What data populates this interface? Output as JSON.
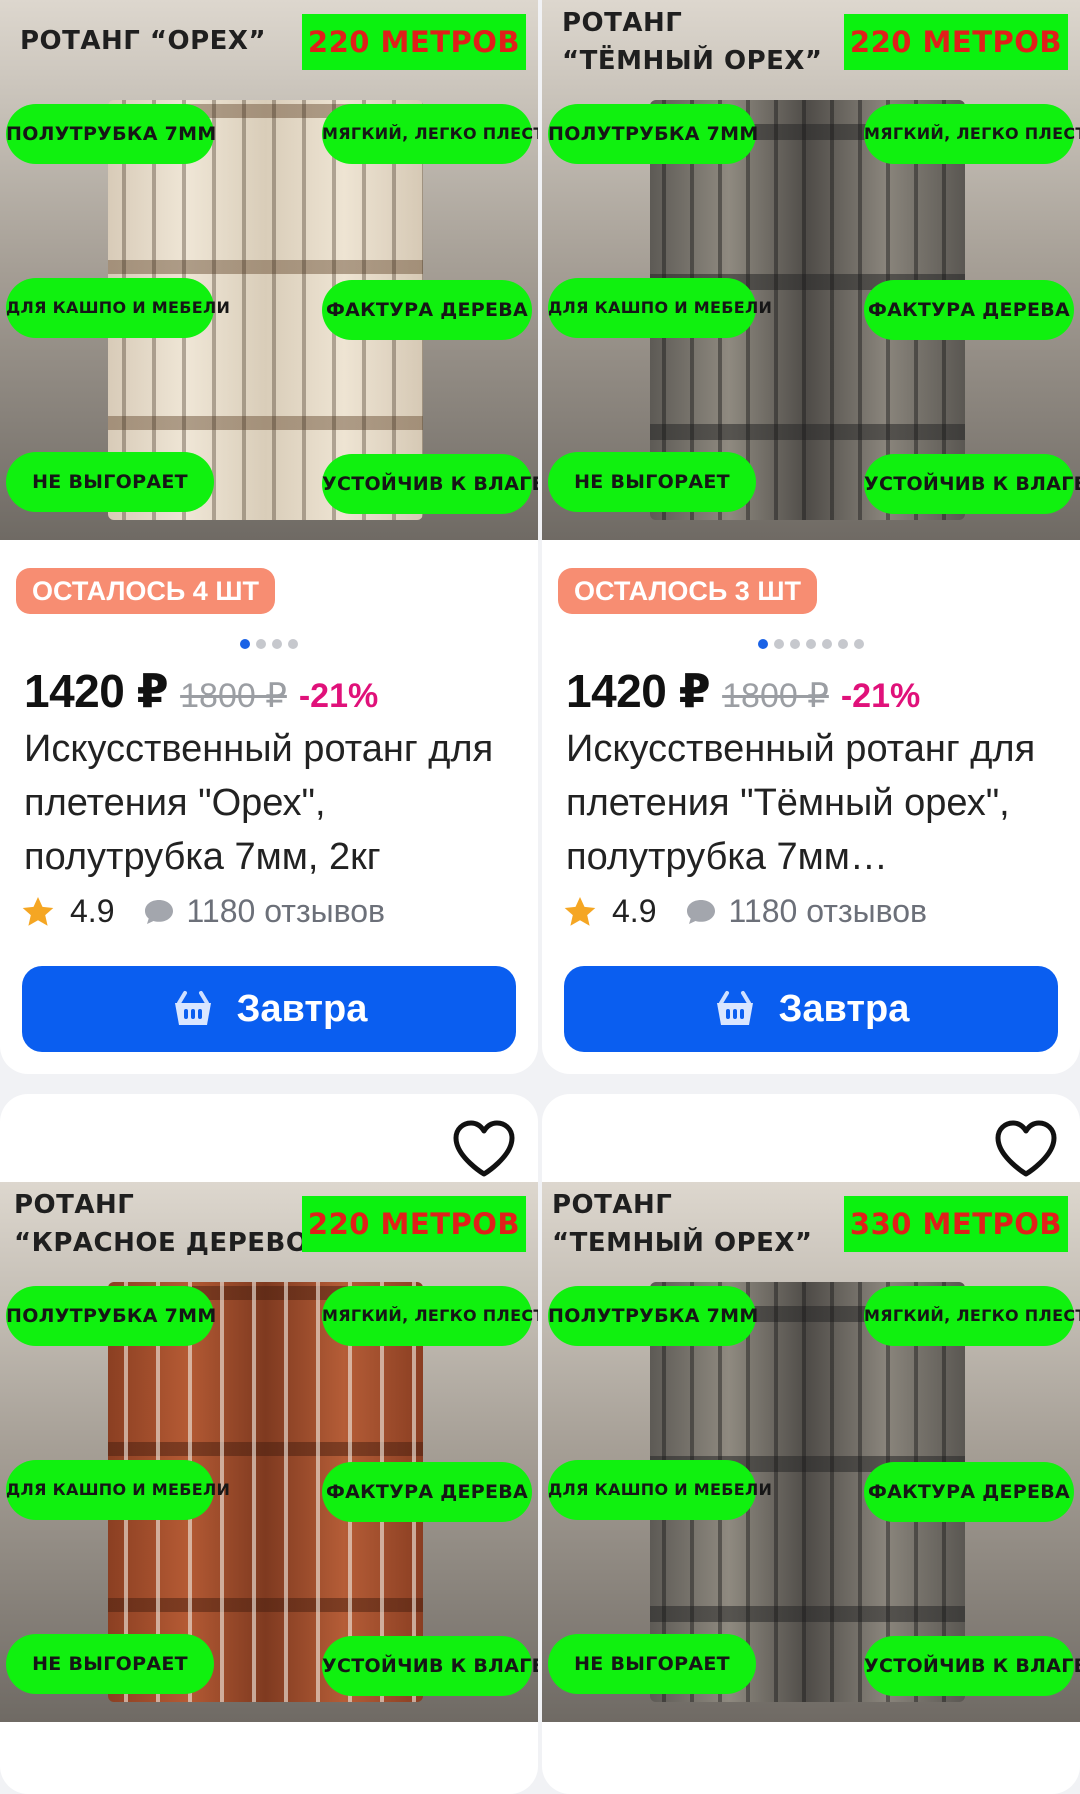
{
  "products": [
    {
      "photo_title": "РОТАНГ “ОРЕХ”",
      "photo_meters": "220 МЕТРОВ",
      "features": [
        "ПОЛУТРУБКА 7ММ",
        "МЯГКИЙ, ЛЕГКО ПЛЕСТИ",
        "ДЛЯ КАШПО И МЕБЕЛИ",
        "ФАКТУРА ДЕРЕВА",
        "НЕ ВЫГОРАЕТ",
        "УСТОЙЧИВ К ВЛАГЕ"
      ],
      "stock_badge": "ОСТАЛОСЬ 4 ШТ",
      "price": "1420 ₽",
      "old_price": "1800 ₽",
      "discount": "-21%",
      "title": "Искусственный ротанг для плетения \"Орех\", полутрубка 7мм, 2кг",
      "rating": "4.9",
      "reviews": "1180 отзывов",
      "button": "Завтра"
    },
    {
      "photo_title": "РОТАНГ\n“ТЁМНЫЙ ОРЕХ”",
      "photo_meters": "220 МЕТРОВ",
      "features": [
        "ПОЛУТРУБКА 7ММ",
        "МЯГКИЙ, ЛЕГКО ПЛЕСТИ",
        "ДЛЯ КАШПО И МЕБЕЛИ",
        "ФАКТУРА ДЕРЕВА",
        "НЕ ВЫГОРАЕТ",
        "УСТОЙЧИВ К ВЛАГЕ"
      ],
      "stock_badge": "ОСТАЛОСЬ 3 ШТ",
      "price": "1420 ₽",
      "old_price": "1800 ₽",
      "discount": "-21%",
      "title": "Искусственный ротанг для плетения \"Тёмный орех\", полутрубка 7мм…",
      "rating": "4.9",
      "reviews": "1180 отзывов",
      "button": "Завтра"
    },
    {
      "photo_title": "РОТАНГ\n“КРАСНОЕ ДЕРЕВО”",
      "photo_meters": "220 МЕТРОВ",
      "features": [
        "ПОЛУТРУБКА 7ММ",
        "МЯГКИЙ, ЛЕГКО ПЛЕСТИ",
        "ДЛЯ КАШПО И МЕБЕЛИ",
        "ФАКТУРА ДЕРЕВА",
        "НЕ ВЫГОРАЕТ",
        "УСТОЙЧИВ К ВЛАГЕ"
      ]
    },
    {
      "photo_title": "РОТАНГ\n“ТЕМНЫЙ ОРЕХ”",
      "photo_meters": "330 МЕТРОВ",
      "features": [
        "ПОЛУТРУБКА 7ММ",
        "МЯГКИЙ, ЛЕГКО ПЛЕСТИ",
        "ДЛЯ КАШПО И МЕБЕЛИ",
        "ФАКТУРА ДЕРЕВА",
        "НЕ ВЫГОРАЕТ",
        "УСТОЙЧИВ К ВЛАГЕ"
      ]
    }
  ],
  "icons": {
    "rating": "star-icon",
    "reviews": "comment-icon",
    "button": "basket-icon",
    "favorite": "heart-icon"
  },
  "carousel": {
    "card1": {
      "slides": 4,
      "active": 1
    },
    "card2": {
      "slides": 7,
      "active": 1
    }
  },
  "colors": {
    "accent": "#0a5ef0",
    "discount": "#e0117a",
    "stock_badge": "#f78d72",
    "feature_pill": "#10f10f",
    "meters_text": "#e0201a"
  }
}
